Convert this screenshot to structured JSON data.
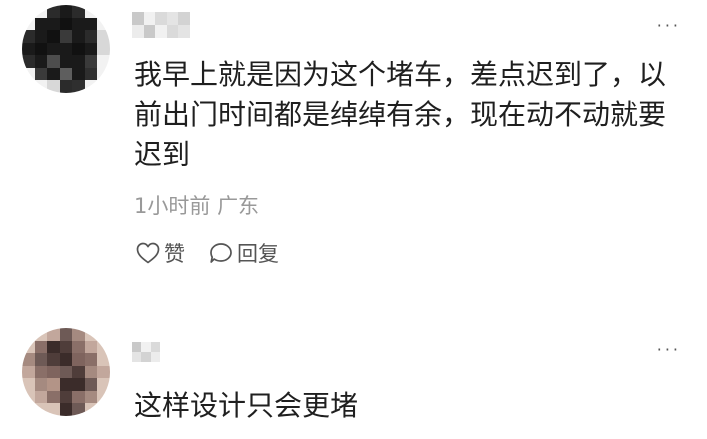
{
  "comments": [
    {
      "text": "我早上就是因为这个堵车，差点迟到了，以前出门时间都是绰绰有余，现在动不动就要迟到",
      "time": "1小时前",
      "location": "广东",
      "like_label": "赞",
      "reply_label": "回复",
      "more_label": "···"
    },
    {
      "text": "这样设计只会更堵",
      "more_label": "···"
    }
  ],
  "icons": {
    "like": "heart-outline-icon",
    "reply": "speech-bubble-outline-icon",
    "more": "ellipsis-icon"
  },
  "colors": {
    "text": "#1f1f1f",
    "meta": "#999999",
    "action": "#555555"
  }
}
